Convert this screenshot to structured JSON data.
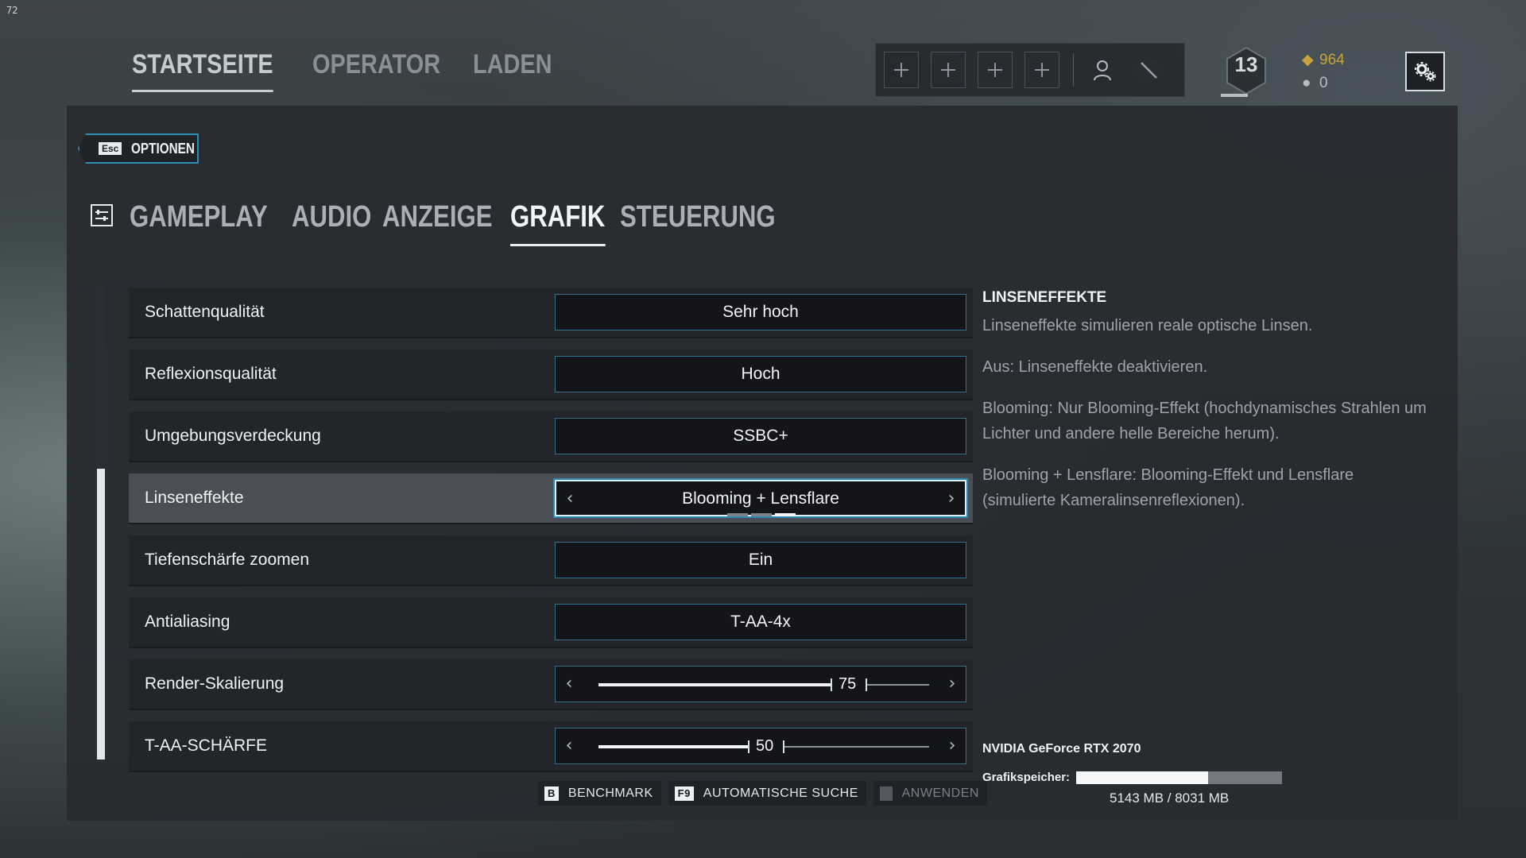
{
  "fps": "72",
  "topnav": {
    "items": [
      "STARTSEITE",
      "OPERATOR",
      "LADEN"
    ]
  },
  "squad": {
    "slots": 4,
    "icons": [
      "plus-icon",
      "person-icon",
      "slash-icon"
    ]
  },
  "level": "13",
  "level_progress": 0.55,
  "currency": {
    "renown": "964",
    "credits": "0"
  },
  "esc": {
    "key": "Esc",
    "label": "OPTIONEN"
  },
  "tabs": [
    "GAMEPLAY",
    "AUDIO",
    "ANZEIGE",
    "GRAFIK",
    "STEUERUNG"
  ],
  "active_tab": "GRAFIK",
  "settings": [
    {
      "label": "Schattenqualität",
      "value": "Sehr hoch"
    },
    {
      "label": "Reflexionsqualität",
      "value": "Hoch"
    },
    {
      "label": "Umgebungsverdeckung",
      "value": "SSBC+"
    },
    {
      "label": "Linseneffekte",
      "value": "Blooming + Lensflare",
      "options_count": 3,
      "selected_index": 2
    },
    {
      "label": "Tiefenschärfe zoomen",
      "value": "Ein"
    },
    {
      "label": "Antialiasing",
      "value": "T-AA-4x"
    },
    {
      "label": "Render-Skalierung",
      "value": "75",
      "fraction": 0.75
    },
    {
      "label": "T-AA-SCHÄRFE",
      "value": "50",
      "fraction": 0.5
    }
  ],
  "buttons": [
    {
      "key": "B",
      "label": "BENCHMARK"
    },
    {
      "key": "F9",
      "label": "AUTOMATISCHE SUCHE"
    },
    {
      "key": "",
      "label": "ANWENDEN"
    }
  ],
  "description": {
    "title": "LINSENEFFEKTE",
    "paragraphs": [
      "Linseneffekte simulieren reale optische Linsen.",
      "Aus: Linseneffekte deaktivieren.",
      "Blooming: Nur Blooming-Effekt (hochdynamisches Strahlen um Lichter und andere helle Bereiche herum).",
      "Blooming + Lensflare: Blooming-Effekt und Lensflare (simulierte Kameralinsenreflexionen)."
    ]
  },
  "gpu": {
    "name": "NVIDIA GeForce RTX 2070",
    "vram_label": "Grafikspeicher:",
    "vram_text": "5143 MB / 8031 MB",
    "vram_fraction": 0.64
  },
  "colors": {
    "accent": "#2e86b3",
    "gold": "#c9a23a"
  }
}
